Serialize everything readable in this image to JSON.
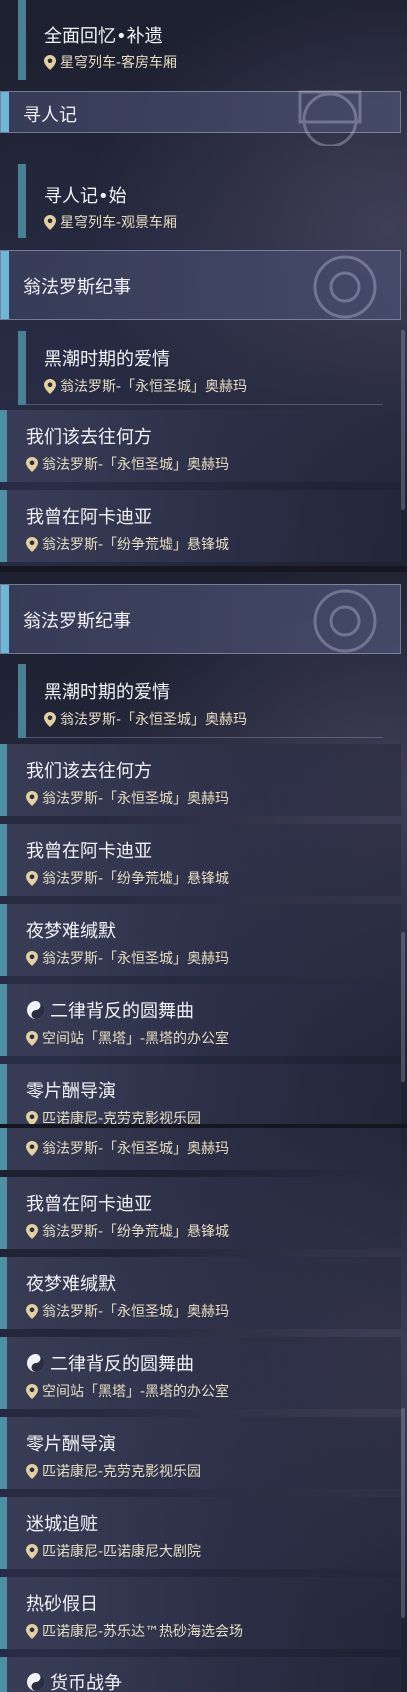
{
  "panel1": {
    "rows": [
      {
        "kind": "sub",
        "title": "全面回忆•补遗",
        "location": "星穹列车-客房车厢"
      },
      {
        "kind": "header",
        "title": "寻人记"
      },
      {
        "kind": "sub",
        "title": "寻人记•始",
        "location": "星穹列车-观景车厢"
      },
      {
        "kind": "header",
        "title": "翁法罗斯纪事"
      },
      {
        "kind": "sub",
        "title": "黑潮时期的爱情",
        "location": "翁法罗斯-「永恒圣城」奥赫玛"
      },
      {
        "kind": "main",
        "title": "我们该去往何方",
        "location": "翁法罗斯-「永恒圣城」奥赫玛"
      },
      {
        "kind": "main",
        "title": "我曾在阿卡迪亚",
        "location": "翁法罗斯-「纷争荒墟」悬锋城"
      }
    ]
  },
  "panel2": {
    "rows": [
      {
        "kind": "header",
        "title": "翁法罗斯纪事"
      },
      {
        "kind": "sub",
        "title": "黑潮时期的爱情",
        "location": "翁法罗斯-「永恒圣城」奥赫玛"
      },
      {
        "kind": "main",
        "title": "我们该去往何方",
        "location": "翁法罗斯-「永恒圣城」奥赫玛"
      },
      {
        "kind": "main",
        "title": "我曾在阿卡迪亚",
        "location": "翁法罗斯-「纷争荒墟」悬锋城"
      },
      {
        "kind": "main",
        "title": "夜梦难缄默",
        "location": "翁法罗斯-「永恒圣城」奥赫玛"
      },
      {
        "kind": "main",
        "title": "二律背反的圆舞曲",
        "location": "空间站「黑塔」-黑塔的办公室",
        "icon": "yin-yang-icon"
      },
      {
        "kind": "main",
        "title": "零片酬导演",
        "location": "匹诺康尼-克劳克影视乐园"
      }
    ]
  },
  "panel3": {
    "rows": [
      {
        "kind": "main",
        "title": "",
        "location": "翁法罗斯-「永恒圣城」奥赫玛"
      },
      {
        "kind": "main",
        "title": "我曾在阿卡迪亚",
        "location": "翁法罗斯-「纷争荒墟」悬锋城"
      },
      {
        "kind": "main",
        "title": "夜梦难缄默",
        "location": "翁法罗斯-「永恒圣城」奥赫玛"
      },
      {
        "kind": "main",
        "title": "二律背反的圆舞曲",
        "location": "空间站「黑塔」-黑塔的办公室",
        "icon": "yin-yang-icon"
      },
      {
        "kind": "main",
        "title": "零片酬导演",
        "location": "匹诺康尼-克劳克影视乐园"
      },
      {
        "kind": "main",
        "title": "迷城追赃",
        "location": "匹诺康尼-匹诺康尼大剧院"
      },
      {
        "kind": "main",
        "title": "热砂假日",
        "location": "匹诺康尼-苏乐达™热砂海选会场"
      },
      {
        "kind": "main",
        "title": "货币战争",
        "location": "",
        "icon": "yin-yang-icon"
      }
    ]
  },
  "colors": {
    "accent_bar": "#4f8fa3",
    "header_bar": "#6db8d8",
    "location_text": "#e7dcc3"
  }
}
